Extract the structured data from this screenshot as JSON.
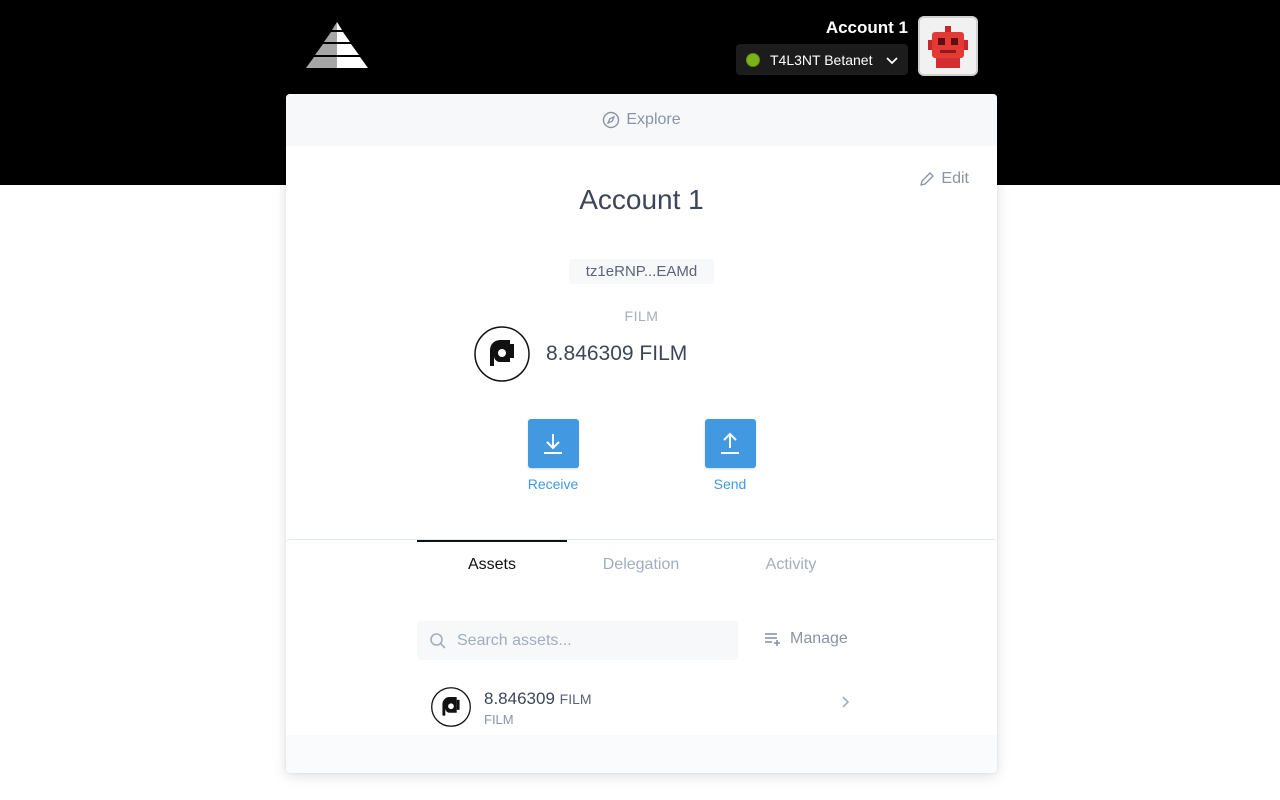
{
  "header": {
    "account_name": "Account 1",
    "network": "T4L3NT Betanet",
    "network_status_color": "#7ab317",
    "logo_icon": "pyramid-logo",
    "avatar_icon": "robot-avatar"
  },
  "card": {
    "explore_label": "Explore",
    "edit_label": "Edit",
    "title": "Account 1",
    "address": "tz1eRNP...EAMd",
    "token_label": "FILM",
    "balance": "8.846309 FILM"
  },
  "actions": {
    "receive_label": "Receive",
    "send_label": "Send",
    "accent_color": "#4299e1"
  },
  "tabs": [
    {
      "label": "Assets",
      "active": true
    },
    {
      "label": "Delegation",
      "active": false
    },
    {
      "label": "Activity",
      "active": false
    }
  ],
  "assets": {
    "search_placeholder": "Search assets...",
    "manage_label": "Manage",
    "items": [
      {
        "amount": "8.846309",
        "symbol": "FILM",
        "name": "FILM"
      }
    ]
  }
}
